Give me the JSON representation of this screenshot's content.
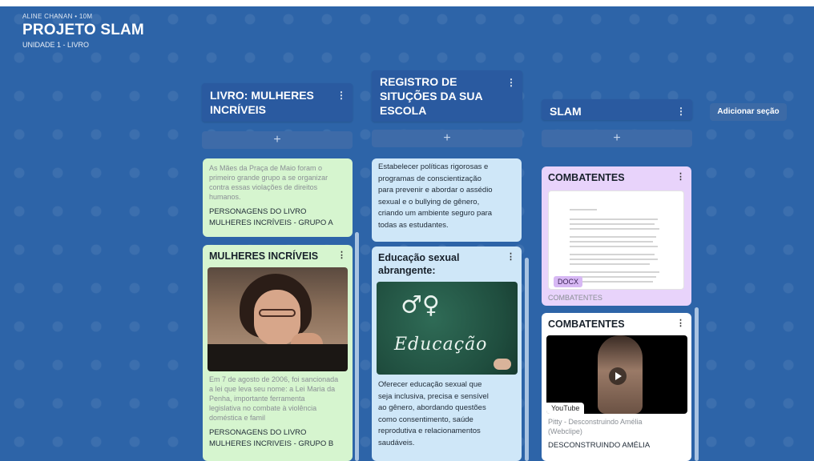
{
  "header": {
    "author": "ALINE CHANAN • 10M",
    "title": "PROJETO SLAM",
    "subtitle": "UNIDADE 1 - LIVRO"
  },
  "columns": [
    {
      "title_line1": "LIVRO: MULHERES",
      "title_line2": "INCRÍVEIS",
      "add": "+"
    },
    {
      "title_line1": "REGISTRO DE",
      "title_line2": "SITUÇÕES DA SUA",
      "title_line3": "ESCOLA",
      "add": "+"
    },
    {
      "title_line1": "SLAM",
      "add": "+"
    }
  ],
  "add_section": "Adicionar seção",
  "col1": {
    "card1": {
      "text_lines": [
        "As Mães da Praça de Maio foram o",
        "primeiro grande grupo a se organizar",
        "contra essas violações de direitos",
        "humanos."
      ],
      "footer_lines": [
        "PERSONAGENS DO LIVRO",
        "MULHERES INCRÍVEIS - GRUPO A"
      ]
    },
    "card2": {
      "title": "MULHERES INCRÍVEIS",
      "text_lines": [
        "Em 7 de agosto de 2006, foi sancionada",
        "a lei que leva seu nome: a Lei Maria da",
        "Penha, importante ferramenta",
        "legislativa no combate à violência",
        "doméstica e famil"
      ],
      "footer_lines": [
        "PERSONAGENS DO LIVRO",
        "MULHERES INCRIVEIS - GRUPO B"
      ]
    }
  },
  "col2": {
    "card1": {
      "text_lines": [
        "Estabelecer políticas rigorosas e",
        "programas de conscientização",
        "para prevenir e abordar o assédio",
        "sexual e o bullying de gênero,",
        "criando um ambiente seguro para",
        "todas as estudantes."
      ]
    },
    "card2": {
      "title_lines": [
        "Educação sexual",
        "abrangente:"
      ],
      "chalk_symbols": "♂♀",
      "chalk_word": "Educação",
      "text_lines": [
        "Oferecer educação sexual que",
        "seja inclusiva, precisa e sensível",
        "ao gênero, abordando questões",
        "como consentimento, saúde",
        "reprodutiva e relacionamentos",
        "saudáveis."
      ]
    }
  },
  "col3": {
    "card1": {
      "title": "COMBATENTES",
      "badge": "DOCX",
      "caption": "COMBATENTES"
    },
    "card2": {
      "title": "COMBATENTES",
      "badge": "YouTube",
      "meta_lines": [
        "Pitty - Desconstruindo Amélia",
        "(Webclipe)"
      ],
      "caption": "DESCONSTRUINDO AMÉLIA"
    }
  },
  "colors": {
    "background": "#2d64a8",
    "card_green": "#d6f5cf",
    "card_blue": "#cfe7f8",
    "card_purple": "#e8d3fb"
  }
}
